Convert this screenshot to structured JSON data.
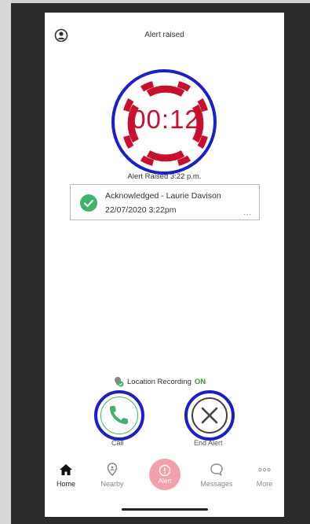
{
  "header": {
    "title": "Alert raised"
  },
  "timer": {
    "value": "00:12"
  },
  "alert_raised_line": "Alert Raised 3:22 p.m.",
  "acknowledgement": {
    "name": "Acknowledged - Laurie Davison",
    "datetime": "22/07/2020 3:22pm",
    "more": "..."
  },
  "location": {
    "prefix": "Location Recording",
    "status": "ON"
  },
  "actions": {
    "call_label": "Call",
    "end_label": "End Alert"
  },
  "tabs": [
    {
      "label": "Home",
      "icon": "home-icon"
    },
    {
      "label": "Nearby",
      "icon": "location-pin-icon"
    },
    {
      "label": "Alert",
      "icon": "alert-icon"
    },
    {
      "label": "Messages",
      "icon": "chat-bubble-icon"
    },
    {
      "label": "More",
      "icon": "more-dots-icon"
    }
  ],
  "colors": {
    "timer_red": "#c8102e",
    "highlight_blue": "#1a1fc7",
    "success_green": "#3fb46a",
    "alert_pink": "#f3a0ad"
  }
}
